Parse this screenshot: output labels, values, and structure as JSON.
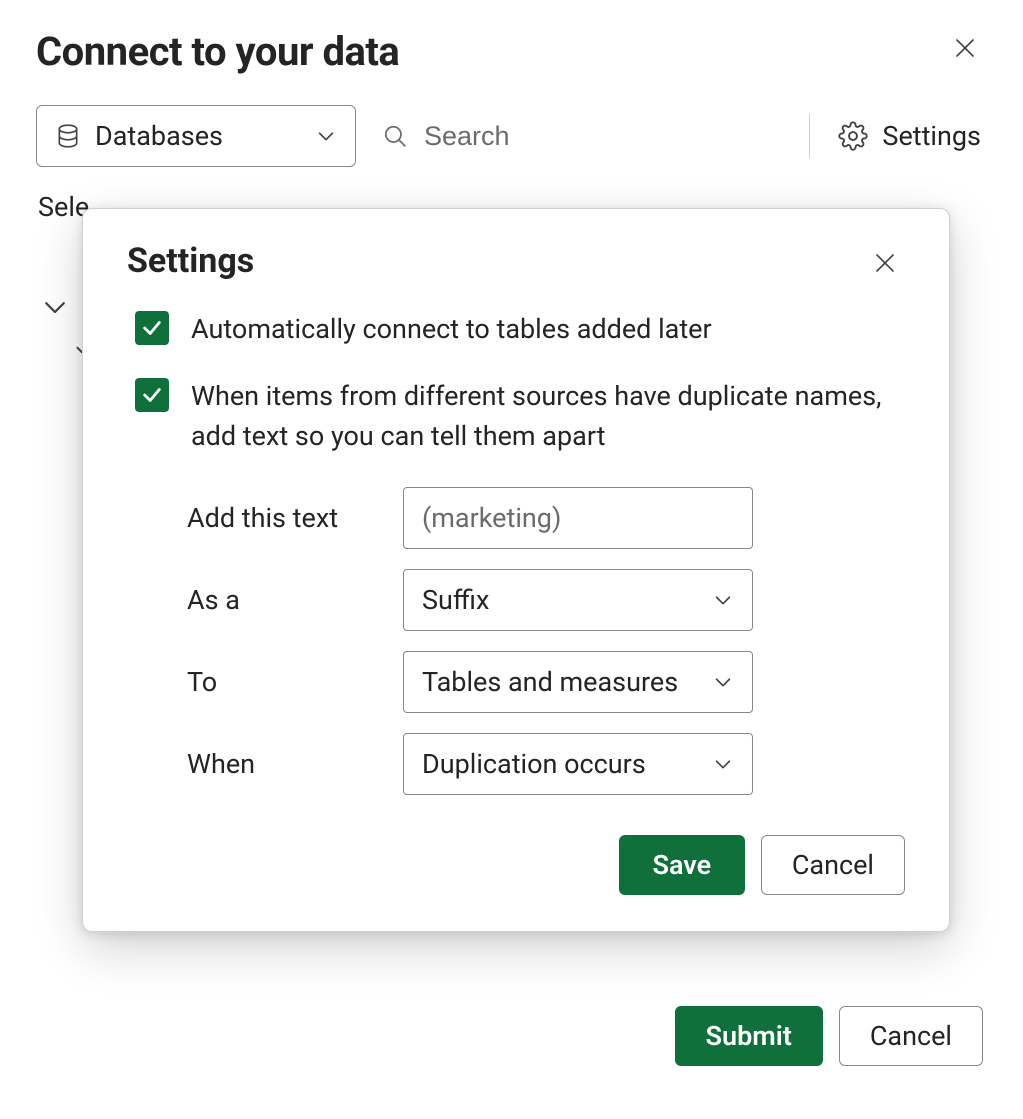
{
  "page": {
    "title": "Connect to your data",
    "select_hint": "Sele"
  },
  "toolbar": {
    "source_selector_label": "Databases",
    "search_placeholder": "Search",
    "settings_label": "Settings"
  },
  "footer": {
    "submit_label": "Submit",
    "cancel_label": "Cancel"
  },
  "settings_dialog": {
    "title": "Settings",
    "option_auto_connect": "Automatically connect to tables added later",
    "option_dedup": "When items from different sources have duplicate names, add text so you can tell them apart",
    "checkbox_auto_connect": true,
    "checkbox_dedup": true,
    "fields": {
      "add_text_label": "Add this text",
      "add_text_value": "(marketing)",
      "as_a_label": "As a",
      "as_a_value": "Suffix",
      "to_label": "To",
      "to_value": "Tables and measures",
      "when_label": "When",
      "when_value": "Duplication occurs"
    },
    "save_label": "Save",
    "cancel_label": "Cancel"
  }
}
